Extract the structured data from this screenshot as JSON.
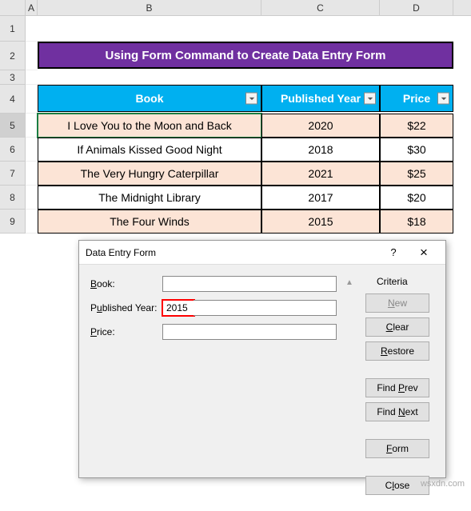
{
  "columns": {
    "A": "A",
    "B": "B",
    "C": "C",
    "D": "D"
  },
  "rows": [
    "1",
    "2",
    "3",
    "4",
    "5",
    "6",
    "7",
    "8",
    "9"
  ],
  "title": "Using Form Command to Create Data Entry Form",
  "headers": {
    "book": "Book",
    "year": "Published Year",
    "price": "Price"
  },
  "table": [
    {
      "book": "I Love You to the Moon and Back",
      "year": "2020",
      "price": "$22"
    },
    {
      "book": "If Animals Kissed Good Night",
      "year": "2018",
      "price": "$30"
    },
    {
      "book": "The Very Hungry Caterpillar",
      "year": "2021",
      "price": "$25"
    },
    {
      "book": "The Midnight Library",
      "year": "2017",
      "price": "$20"
    },
    {
      "book": "The Four Winds",
      "year": "2015",
      "price": "$18"
    }
  ],
  "dialog": {
    "title": "Data Entry Form",
    "labels": {
      "book": "Book:",
      "year": "Published Year:",
      "price": "Price:"
    },
    "values": {
      "book": "",
      "year": "2015",
      "price": ""
    },
    "criteria": "Criteria",
    "buttons": {
      "new": "New",
      "clear": "Clear",
      "restore": "Restore",
      "findprev": "Find Prev",
      "findnext": "Find Next",
      "form": "Form",
      "close": "Close"
    },
    "help": "?",
    "close": "×"
  },
  "watermark": "wsxdn.com"
}
